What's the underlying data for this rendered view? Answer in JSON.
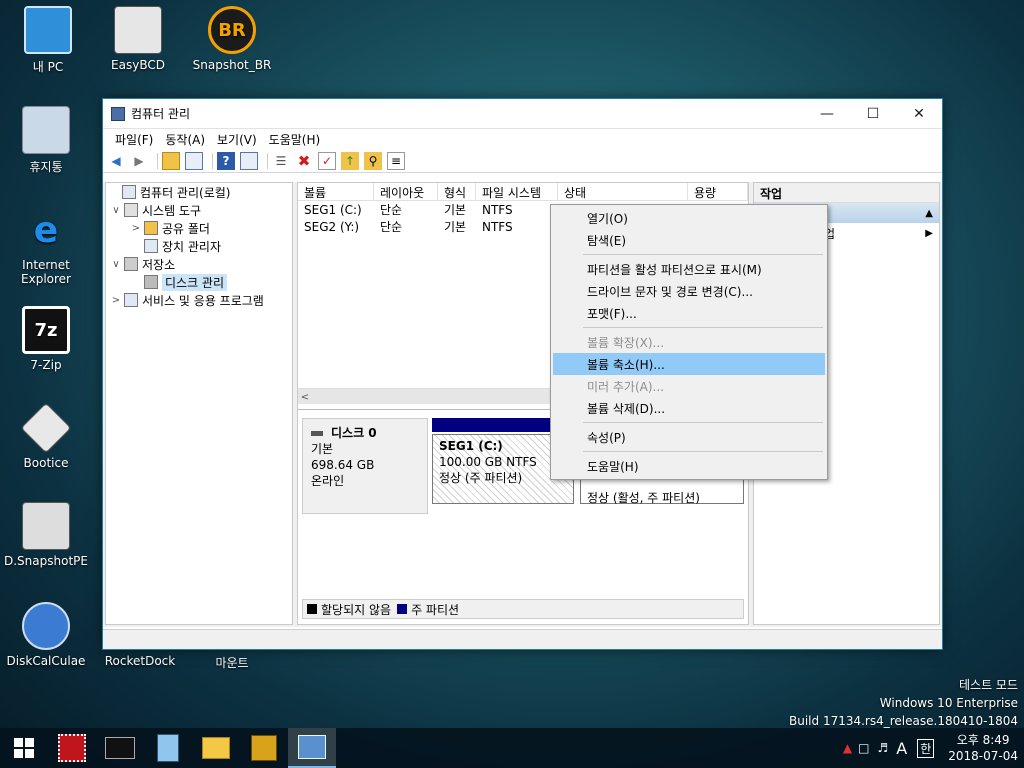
{
  "desktop": {
    "icons": [
      {
        "label": "내 PC",
        "icon": "this-pc-icon"
      },
      {
        "label": "EasyBCD",
        "icon": "easybcd-icon"
      },
      {
        "label": "Snapshot_BR",
        "icon": "snapshot-br-icon",
        "glyph": "BR"
      },
      {
        "label": "휴지통",
        "icon": "recycle-bin-icon"
      },
      {
        "label": "Internet Explorer",
        "icon": "internet-explorer-icon"
      },
      {
        "label": "7-Zip",
        "icon": "7zip-icon",
        "glyph": "7z"
      },
      {
        "label": "Bootice",
        "icon": "bootice-icon"
      },
      {
        "label": "D.SnapshotPE",
        "icon": "dsnapshotpe-icon"
      },
      {
        "label": "DiskCalCulae",
        "icon": "diskcalculae-icon"
      },
      {
        "label": "RocketDock",
        "icon": "rocketdock-icon"
      },
      {
        "label": "마운트",
        "icon": "mount-icon"
      }
    ]
  },
  "window": {
    "title": "컴퓨터 관리",
    "menu": [
      "파일(F)",
      "동작(A)",
      "보기(V)",
      "도움말(H)"
    ],
    "tree": [
      {
        "label": "컴퓨터 관리(로컬)",
        "level": 0,
        "expander": ""
      },
      {
        "label": "시스템 도구",
        "level": 1,
        "expander": "∨"
      },
      {
        "label": "공유 폴더",
        "level": 2,
        "expander": ">"
      },
      {
        "label": "장치 관리자",
        "level": 2,
        "expander": ""
      },
      {
        "label": "저장소",
        "level": 1,
        "expander": "∨"
      },
      {
        "label": "디스크 관리",
        "level": 2,
        "expander": "",
        "selected": true
      },
      {
        "label": "서비스 및 응용 프로그램",
        "level": 1,
        "expander": ">"
      }
    ],
    "volume_headers": [
      "볼륨",
      "레이아웃",
      "형식",
      "파일 시스템",
      "상태",
      "용량"
    ],
    "volumes": [
      [
        "SEG1 (C:)",
        "단순",
        "기본",
        "NTFS"
      ],
      [
        "SEG2 (Y:)",
        "단순",
        "기본",
        "NTFS"
      ]
    ],
    "disk": {
      "name": "디스크 0",
      "type": "기본",
      "size": "698.64 GB",
      "status": "온라인",
      "part_name": "SEG1 (C:)",
      "part_size": "100.00 GB NTFS",
      "part_status": "정상 (주 파티션)",
      "part2_status": "정상 (활성, 주 파티션)"
    },
    "legend": [
      "할당되지 않음",
      "주 파티션"
    ],
    "actions_header": "작업",
    "actions_sub": "업"
  },
  "context_menu": [
    {
      "label": "열기(O)"
    },
    {
      "label": "탐색(E)"
    },
    {
      "sep": true
    },
    {
      "label": "파티션을 활성 파티션으로 표시(M)"
    },
    {
      "label": "드라이브 문자 및 경로 변경(C)..."
    },
    {
      "label": "포맷(F)..."
    },
    {
      "sep": true
    },
    {
      "label": "볼륨 확장(X)...",
      "disabled": true
    },
    {
      "label": "볼륨 축소(H)...",
      "highlighted": true
    },
    {
      "label": "미러 추가(A)...",
      "disabled": true
    },
    {
      "label": "볼륨 삭제(D)..."
    },
    {
      "sep": true
    },
    {
      "label": "속성(P)"
    },
    {
      "sep": true
    },
    {
      "label": "도움말(H)"
    }
  ],
  "watermark": {
    "line1": "테스트 모드",
    "line2": "Windows 10 Enterprise",
    "line3": "Build 17134.rs4_release.180410-1804"
  },
  "tray": {
    "time": "오후 8:49",
    "date": "2018-07-04",
    "ime": "A",
    "lang": "한"
  }
}
